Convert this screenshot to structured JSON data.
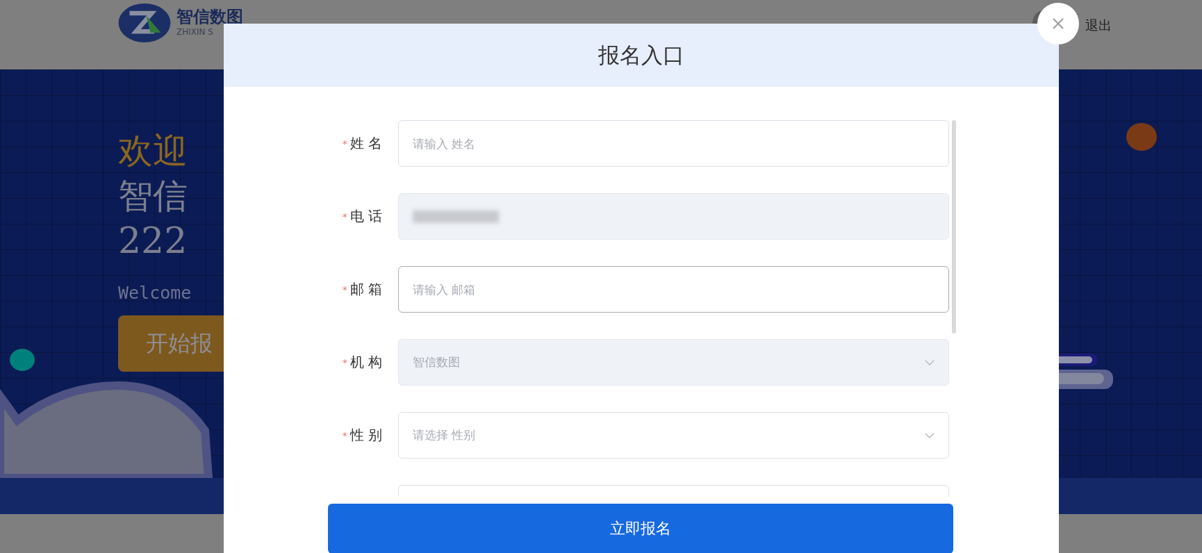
{
  "header": {
    "logo_text": "智信数图",
    "logo_subtext": "ZHIXIN S",
    "logout": "退出"
  },
  "banner": {
    "welcome": "欢迎",
    "title": "智信",
    "number": "222",
    "subtitle": "Welcome",
    "button": "开始报"
  },
  "dialog": {
    "title": "报名入口",
    "submit": "立即报名",
    "fields": [
      {
        "mark": "*",
        "label": "姓 名",
        "kind": "input",
        "placeholder": "请输入 姓名",
        "disabled": false,
        "focused": false
      },
      {
        "mark": "*",
        "label": "电 话",
        "kind": "input",
        "disabled": true,
        "focused": false,
        "redacted": true
      },
      {
        "mark": "*",
        "label": "邮 箱",
        "kind": "input",
        "placeholder": "请输入 邮箱",
        "disabled": false,
        "focused": true
      },
      {
        "mark": "*",
        "label": "机 构",
        "kind": "select",
        "value": "智信数图",
        "disabled": true,
        "focused": false
      },
      {
        "mark": "*",
        "label": "性 别",
        "kind": "select",
        "placeholder": "请选择 性别",
        "disabled": false,
        "focused": false
      },
      {
        "kind": "input",
        "disabled": false,
        "focused": false
      }
    ]
  }
}
